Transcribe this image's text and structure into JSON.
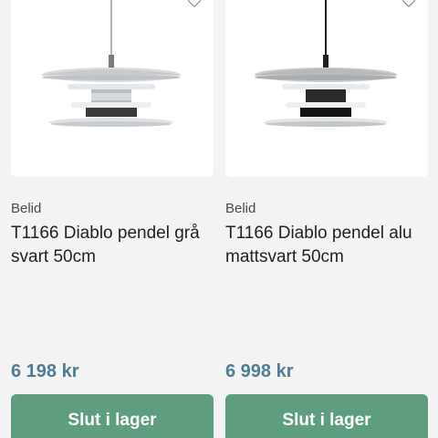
{
  "products": [
    {
      "brand": "Belid",
      "title": "T1166 Diablo pendel grå svart 50cm",
      "price": "6 198 kr",
      "button_label": "Slut i lager",
      "wishlist_icon": "heart-outline-icon"
    },
    {
      "brand": "Belid",
      "title": "T1166 Diablo pendel alu mattsvart 50cm",
      "price": "6 998 kr",
      "button_label": "Slut i lager",
      "wishlist_icon": "heart-outline-icon"
    }
  ],
  "colors": {
    "page_background": "#f3f3f3",
    "price": "#4f7d92",
    "button": "#5f9d80"
  }
}
